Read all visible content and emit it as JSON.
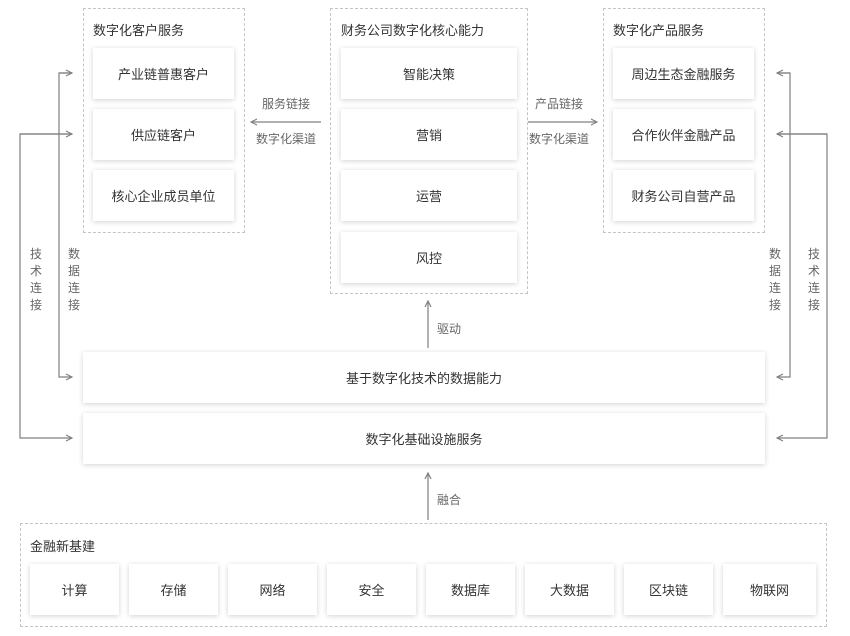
{
  "customer_services": {
    "title": "数字化客户服务",
    "items": [
      "产业链普惠客户",
      "供应链客户",
      "核心企业成员单位"
    ]
  },
  "core_capabilities": {
    "title": "财务公司数字化核心能力",
    "items": [
      "智能决策",
      "营销",
      "运营",
      "风控"
    ]
  },
  "product_services": {
    "title": "数字化产品服务",
    "items": [
      "周边生态金融服务",
      "合作伙伴金融产品",
      "财务公司自营产品"
    ]
  },
  "left_link": {
    "label1": "服务链接",
    "label2": "数字化渠道"
  },
  "right_link": {
    "label1": "产品链接",
    "label2": "数字化渠道"
  },
  "left_side": {
    "tech": "技术连接",
    "data": "数据连接"
  },
  "right_side": {
    "tech": "技术连接",
    "data": "数据连接"
  },
  "drive_label": "驱动",
  "data_capability": "基于数字化技术的数据能力",
  "infra_service": "数字化基础设施服务",
  "fusion_label": "融合",
  "new_infra": {
    "title": "金融新基建",
    "items": [
      "计算",
      "存储",
      "网络",
      "安全",
      "数据库",
      "大数据",
      "区块链",
      "物联网"
    ]
  },
  "colors": {
    "arrow": "#808080",
    "dashed_border": "#c4c4c4",
    "text": "#333333"
  }
}
